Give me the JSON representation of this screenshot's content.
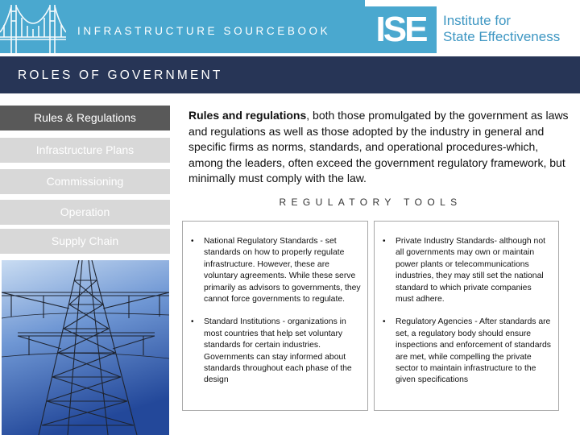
{
  "header": {
    "sourcebook_title": "INFRASTRUCTURE SOURCEBOOK",
    "logo_mark": "ISE",
    "logo_line1": "Institute for",
    "logo_line2": "State Effectiveness",
    "colors": {
      "banner": "#4aa8cf",
      "logo_text": "#3d96c2"
    }
  },
  "section": {
    "title": "ROLES OF GOVERNMENT",
    "color": "#273556"
  },
  "nav": {
    "items": [
      {
        "label": "Rules & Regulations",
        "active": true
      },
      {
        "label": "Infrastructure Plans",
        "active": false
      },
      {
        "label": "Commissioning",
        "active": false
      },
      {
        "label": "Operation",
        "active": false
      },
      {
        "label": "Supply Chain",
        "active": false
      }
    ],
    "colors": {
      "active": "#595959",
      "inactive": "#d8d8d8"
    }
  },
  "intro": {
    "bold": "Rules and regulations",
    "text": ", both those promulgated by the government as laws and regulations as well as those adopted by the industry in general and specific firms as norms, standards, and operational procedures-which, among the leaders, often exceed the government regulatory framework, but minimally must comply with the law."
  },
  "tools": {
    "heading": "REGULATORY TOOLS",
    "left": [
      "National Regulatory Standards - set standards on how to properly regulate infrastructure. However, these are voluntary agreements. While these serve primarily as advisors to governments, they cannot force governments to regulate.",
      "Standard Institutions - organizations in most countries that help set voluntary standards for certain industries. Governments can stay informed about standards throughout each phase of the design"
    ],
    "right": [
      "Private Industry Standards- although not all governments may own or maintain power plants or telecommunications industries, they may still set the national standard to which private companies must adhere.",
      "Regulatory Agencies - After standards are set, a regulatory body should ensure inspections and enforcement of standards are met, while compelling the private sector to maintain infrastructure to the given specifications"
    ],
    "bullet": "•"
  },
  "image": {
    "subject": "electricity-pylon"
  }
}
